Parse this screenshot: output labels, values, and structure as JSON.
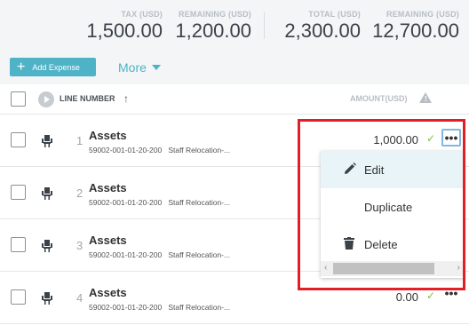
{
  "totals": [
    {
      "label": "TAX (USD)",
      "value": "1,500.00"
    },
    {
      "label": "REMAINING (USD)",
      "value": "1,200.00"
    },
    {
      "label": "TOTAL (USD)",
      "value": "2,300.00"
    },
    {
      "label": "REMAINING (USD)",
      "value": "12,700.00"
    }
  ],
  "toolbar": {
    "add_label": "Add Expense",
    "more_label": "More"
  },
  "columns": {
    "line_number": "LINE NUMBER",
    "amount": "AMOUNT(USD)"
  },
  "rows": [
    {
      "num": "1",
      "title": "Assets",
      "code": "59002-001-01-20-200",
      "desc": "Staff Relocation-...",
      "amount": "1,000.00"
    },
    {
      "num": "2",
      "title": "Assets",
      "code": "59002-001-01-20-200",
      "desc": "Staff Relocation-...",
      "amount": ""
    },
    {
      "num": "3",
      "title": "Assets",
      "code": "59002-001-01-20-200",
      "desc": "Staff Relocation-...",
      "amount": ""
    },
    {
      "num": "4",
      "title": "Assets",
      "code": "59002-001-01-20-200",
      "desc": "Staff Relocation-...",
      "amount": "0.00"
    }
  ],
  "menu": {
    "edit": "Edit",
    "duplicate": "Duplicate",
    "delete": "Delete"
  },
  "colors": {
    "accent": "#4fb3c8",
    "highlight_box": "#e41e26",
    "check": "#7bc142"
  }
}
